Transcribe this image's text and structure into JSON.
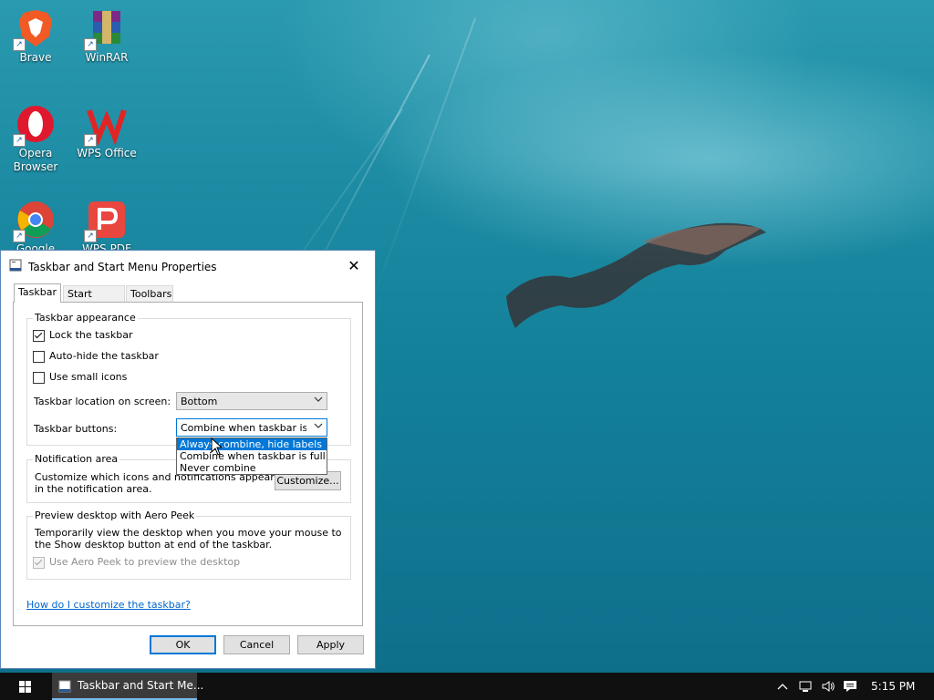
{
  "desktop": {
    "icons": [
      {
        "label": "Brave",
        "icon": "brave-icon"
      },
      {
        "label": "WinRAR",
        "icon": "winrar-icon"
      },
      {
        "label": "Opera Browser",
        "icon": "opera-icon"
      },
      {
        "label": "WPS Office",
        "icon": "wps-office-icon"
      },
      {
        "label": "Google Chrome",
        "icon": "chrome-icon"
      },
      {
        "label": "WPS PDF",
        "icon": "wps-pdf-icon"
      }
    ]
  },
  "dialog": {
    "title": "Taskbar and Start Menu Properties",
    "close_symbol": "✕",
    "tabs": [
      {
        "label": "Taskbar",
        "active": true
      },
      {
        "label": "Start Menu",
        "active": false
      },
      {
        "label": "Toolbars",
        "active": false
      }
    ],
    "appearance": {
      "legend": "Taskbar appearance",
      "lock_taskbar": {
        "label": "Lock the taskbar",
        "checked": true
      },
      "auto_hide": {
        "label": "Auto-hide the taskbar",
        "checked": false
      },
      "small_icons": {
        "label": "Use small icons",
        "checked": false
      },
      "location_label": "Taskbar location on screen:",
      "location_value": "Bottom",
      "buttons_label": "Taskbar buttons:",
      "buttons_value": "Combine when taskbar is fu",
      "buttons_options": [
        {
          "label": "Always combine, hide labels",
          "selected": true
        },
        {
          "label": "Combine when taskbar is full",
          "selected": false
        },
        {
          "label": "Never combine",
          "selected": false
        }
      ]
    },
    "notification": {
      "legend": "Notification area",
      "text_line1": "Customize which icons and notifications appear",
      "text_line2": "in the notification area.",
      "customize_button": "Customize..."
    },
    "aero_peek": {
      "legend": "Preview desktop with Aero Peek",
      "text_line1": "Temporarily view the desktop when you move your mouse to",
      "text_line2": "the Show desktop button at end of the taskbar.",
      "checkbox": {
        "label": "Use Aero Peek to preview the desktop",
        "checked": true,
        "disabled": true
      }
    },
    "help_link": "How do I customize the taskbar?",
    "buttons": {
      "ok": "OK",
      "cancel": "Cancel",
      "apply": "Apply"
    }
  },
  "taskbar": {
    "start_icon": "windows-logo-icon",
    "active_task": "Taskbar and Start Me...",
    "tray_icons": [
      "chevron-up-icon",
      "network-icon",
      "volume-icon",
      "action-center-icon"
    ],
    "clock": "5:15 PM"
  },
  "colors": {
    "accent": "#0078d7",
    "link": "#0066cc",
    "taskbar": "#101010",
    "wallpaper": "#1b8aa2"
  }
}
